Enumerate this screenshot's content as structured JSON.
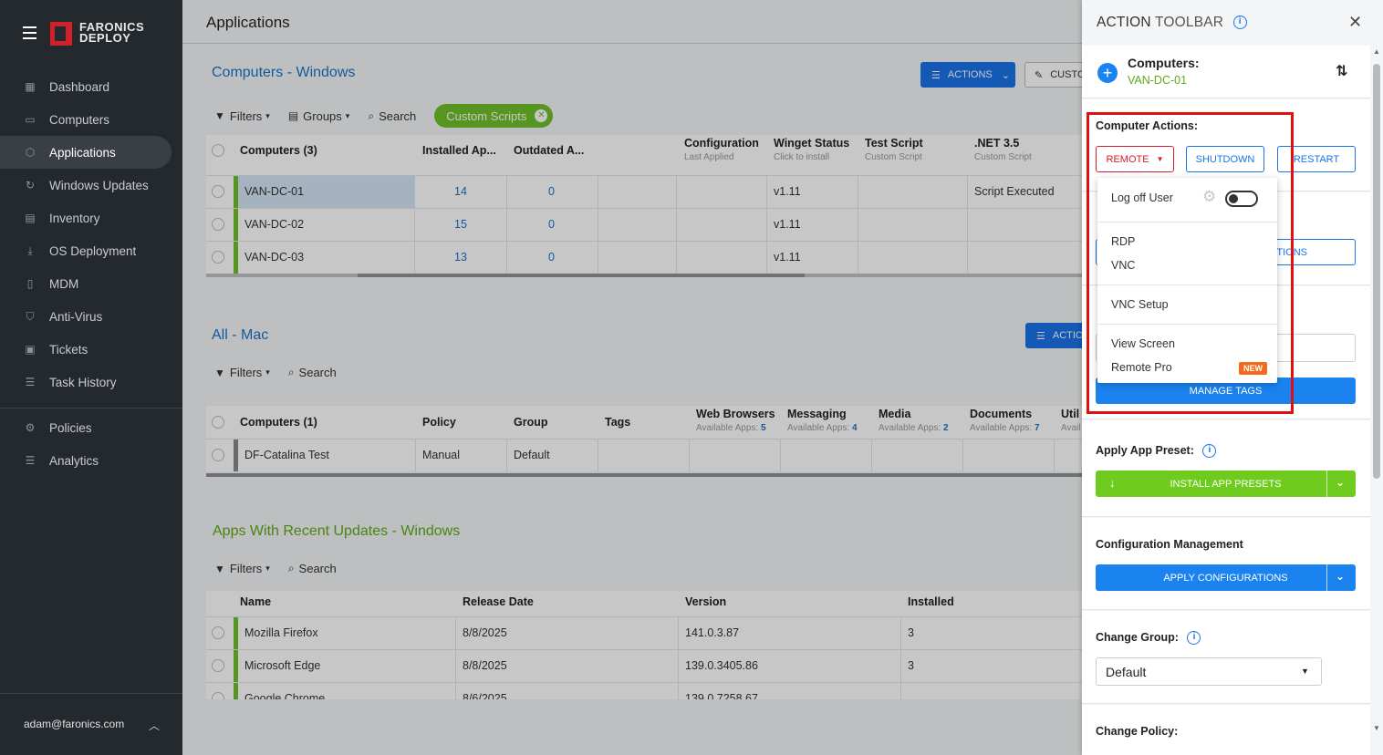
{
  "sidebar": {
    "logo_line1": "FARONICS",
    "logo_line2": "DEPLOY",
    "items": [
      {
        "label": "Dashboard",
        "icon": "dashboard-icon"
      },
      {
        "label": "Computers",
        "icon": "monitor-icon"
      },
      {
        "label": "Applications",
        "icon": "box-icon",
        "active": true
      },
      {
        "label": "Windows Updates",
        "icon": "refresh-icon"
      },
      {
        "label": "Inventory",
        "icon": "clipboard-icon"
      },
      {
        "label": "OS Deployment",
        "icon": "download-icon"
      },
      {
        "label": "MDM",
        "icon": "phone-icon"
      },
      {
        "label": "Anti-Virus",
        "icon": "shield-icon"
      },
      {
        "label": "Tickets",
        "icon": "ticket-icon"
      },
      {
        "label": "Task History",
        "icon": "list-icon"
      }
    ],
    "items2": [
      {
        "label": "Policies",
        "icon": "gear-icon"
      },
      {
        "label": "Analytics",
        "icon": "list-icon"
      }
    ],
    "user": "adam@faronics.com"
  },
  "main": {
    "title": "Applications",
    "windows": {
      "title": "Computers - Windows",
      "actions_label": "ACTIONS",
      "custom_label": "CUSTO",
      "filters": "Filters",
      "groups": "Groups",
      "search": "Search",
      "chip": "Custom Scripts",
      "headers": [
        {
          "title": "Computers (3)",
          "sub": ""
        },
        {
          "title": "Installed Ap...",
          "sub": ""
        },
        {
          "title": "Outdated A...",
          "sub": ""
        },
        {
          "title": "Configuration",
          "sub": "Last Applied"
        },
        {
          "title": "Winget Status",
          "sub": "Click to install"
        },
        {
          "title": "Test Script",
          "sub": "Custom Script"
        },
        {
          "title": ".NET 3.5",
          "sub": "Custom Script"
        }
      ],
      "rows": [
        {
          "name": "VAN-DC-01",
          "installed": "14",
          "outdated": "0",
          "winget": "v1.11",
          "net": "Script Executed"
        },
        {
          "name": "VAN-DC-02",
          "installed": "15",
          "outdated": "0",
          "winget": "v1.11",
          "net": ""
        },
        {
          "name": "VAN-DC-03",
          "installed": "13",
          "outdated": "0",
          "winget": "v1.11",
          "net": ""
        }
      ]
    },
    "mac": {
      "title": "All - Mac",
      "actions_label": "ACTIO",
      "filters": "Filters",
      "search": "Search",
      "headers": [
        {
          "title": "Computers (1)",
          "sub": ""
        },
        {
          "title": "Policy",
          "sub": ""
        },
        {
          "title": "Group",
          "sub": ""
        },
        {
          "title": "Tags",
          "sub": ""
        },
        {
          "title": "Web Browsers",
          "sub": "Available Apps: ",
          "n": "5"
        },
        {
          "title": "Messaging",
          "sub": "Available Apps: ",
          "n": "4"
        },
        {
          "title": "Media",
          "sub": "Available Apps: ",
          "n": "2"
        },
        {
          "title": "Documents",
          "sub": "Available Apps: ",
          "n": "7"
        },
        {
          "title": "Util",
          "sub": "Avail",
          "n": ""
        }
      ],
      "rows": [
        {
          "name": "DF-Catalina Test",
          "policy": "Manual",
          "group": "Default"
        }
      ]
    },
    "updates": {
      "title": "Apps With Recent Updates - Windows",
      "filters": "Filters",
      "search": "Search",
      "headers": [
        "Name",
        "Release Date",
        "Version",
        "Installed"
      ],
      "rows": [
        {
          "name": "Mozilla Firefox",
          "date": "8/8/2025",
          "version": "141.0.3.87",
          "installed": "3"
        },
        {
          "name": "Microsoft Edge",
          "date": "8/8/2025",
          "version": "139.0.3405.86",
          "installed": "3"
        },
        {
          "name": "Google Chrome",
          "date": "8/6/2025",
          "version": "139.0.7258.67",
          "installed": ""
        }
      ]
    }
  },
  "panel": {
    "title_a": "ACTION",
    "title_b": " TOOLBAR",
    "computers_label": "Computers:",
    "computers_value": "VAN-DC-01",
    "computer_actions": "Computer Actions:",
    "remote": "REMOTE",
    "shutdown": "SHUTDOWN",
    "restart": "RESTART",
    "tions_fragment": "TIONS",
    "manage_tags": "MANAGE TAGS",
    "apply_preset": "Apply App Preset:",
    "install_presets": "INSTALL APP PRESETS",
    "config_mgmt": "Configuration Management",
    "apply_configs": "APPLY CONFIGURATIONS",
    "change_group": "Change Group:",
    "group_value": "Default",
    "change_policy": "Change Policy:"
  },
  "dropdown": {
    "log_off": "Log off User",
    "rdp": "RDP",
    "vnc": "VNC",
    "vnc_setup": "VNC Setup",
    "view_screen": "View Screen",
    "remote_pro": "Remote Pro",
    "new_badge": "NEW"
  }
}
